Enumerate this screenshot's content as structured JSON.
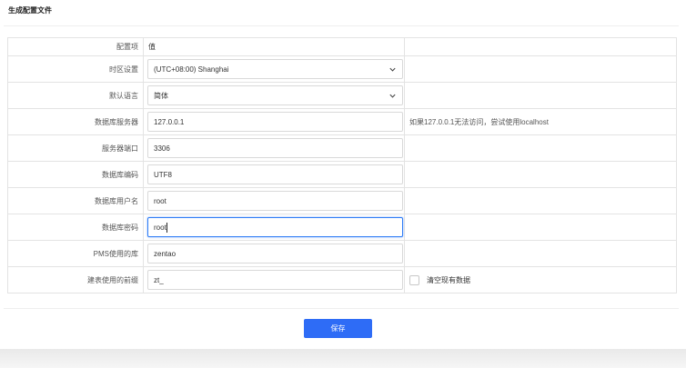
{
  "page": {
    "title": "生成配置文件",
    "save_label": "保存"
  },
  "table": {
    "header": {
      "label": "配置项",
      "value": "值"
    },
    "rows": [
      {
        "label": "时区设置",
        "value": "(UTC+08:00) Shanghai",
        "type": "select",
        "note": ""
      },
      {
        "label": "默认语言",
        "value": "简体",
        "type": "select",
        "note": ""
      },
      {
        "label": "数据库服务器",
        "value": "127.0.0.1",
        "type": "input",
        "note": "如果127.0.0.1无法访问，尝试使用localhost"
      },
      {
        "label": "服务器端口",
        "value": "3306",
        "type": "input",
        "note": ""
      },
      {
        "label": "数据库编码",
        "value": "UTF8",
        "type": "input",
        "note": ""
      },
      {
        "label": "数据库用户名",
        "value": "root",
        "type": "input",
        "note": ""
      },
      {
        "label": "数据库密码",
        "value": "root",
        "type": "input",
        "note": "",
        "focused": true
      },
      {
        "label": "PMS使用的库",
        "value": "zentao",
        "type": "input",
        "note": ""
      },
      {
        "label": "建表使用的前缀",
        "value": "zt_",
        "type": "input",
        "note": ""
      }
    ],
    "clear_data_label": "清空现有数据",
    "clear_data_checked": false
  },
  "colors": {
    "accent": "#2e6cf6",
    "focus_border": "#2e7cf6",
    "border": "#e3e3e3"
  }
}
